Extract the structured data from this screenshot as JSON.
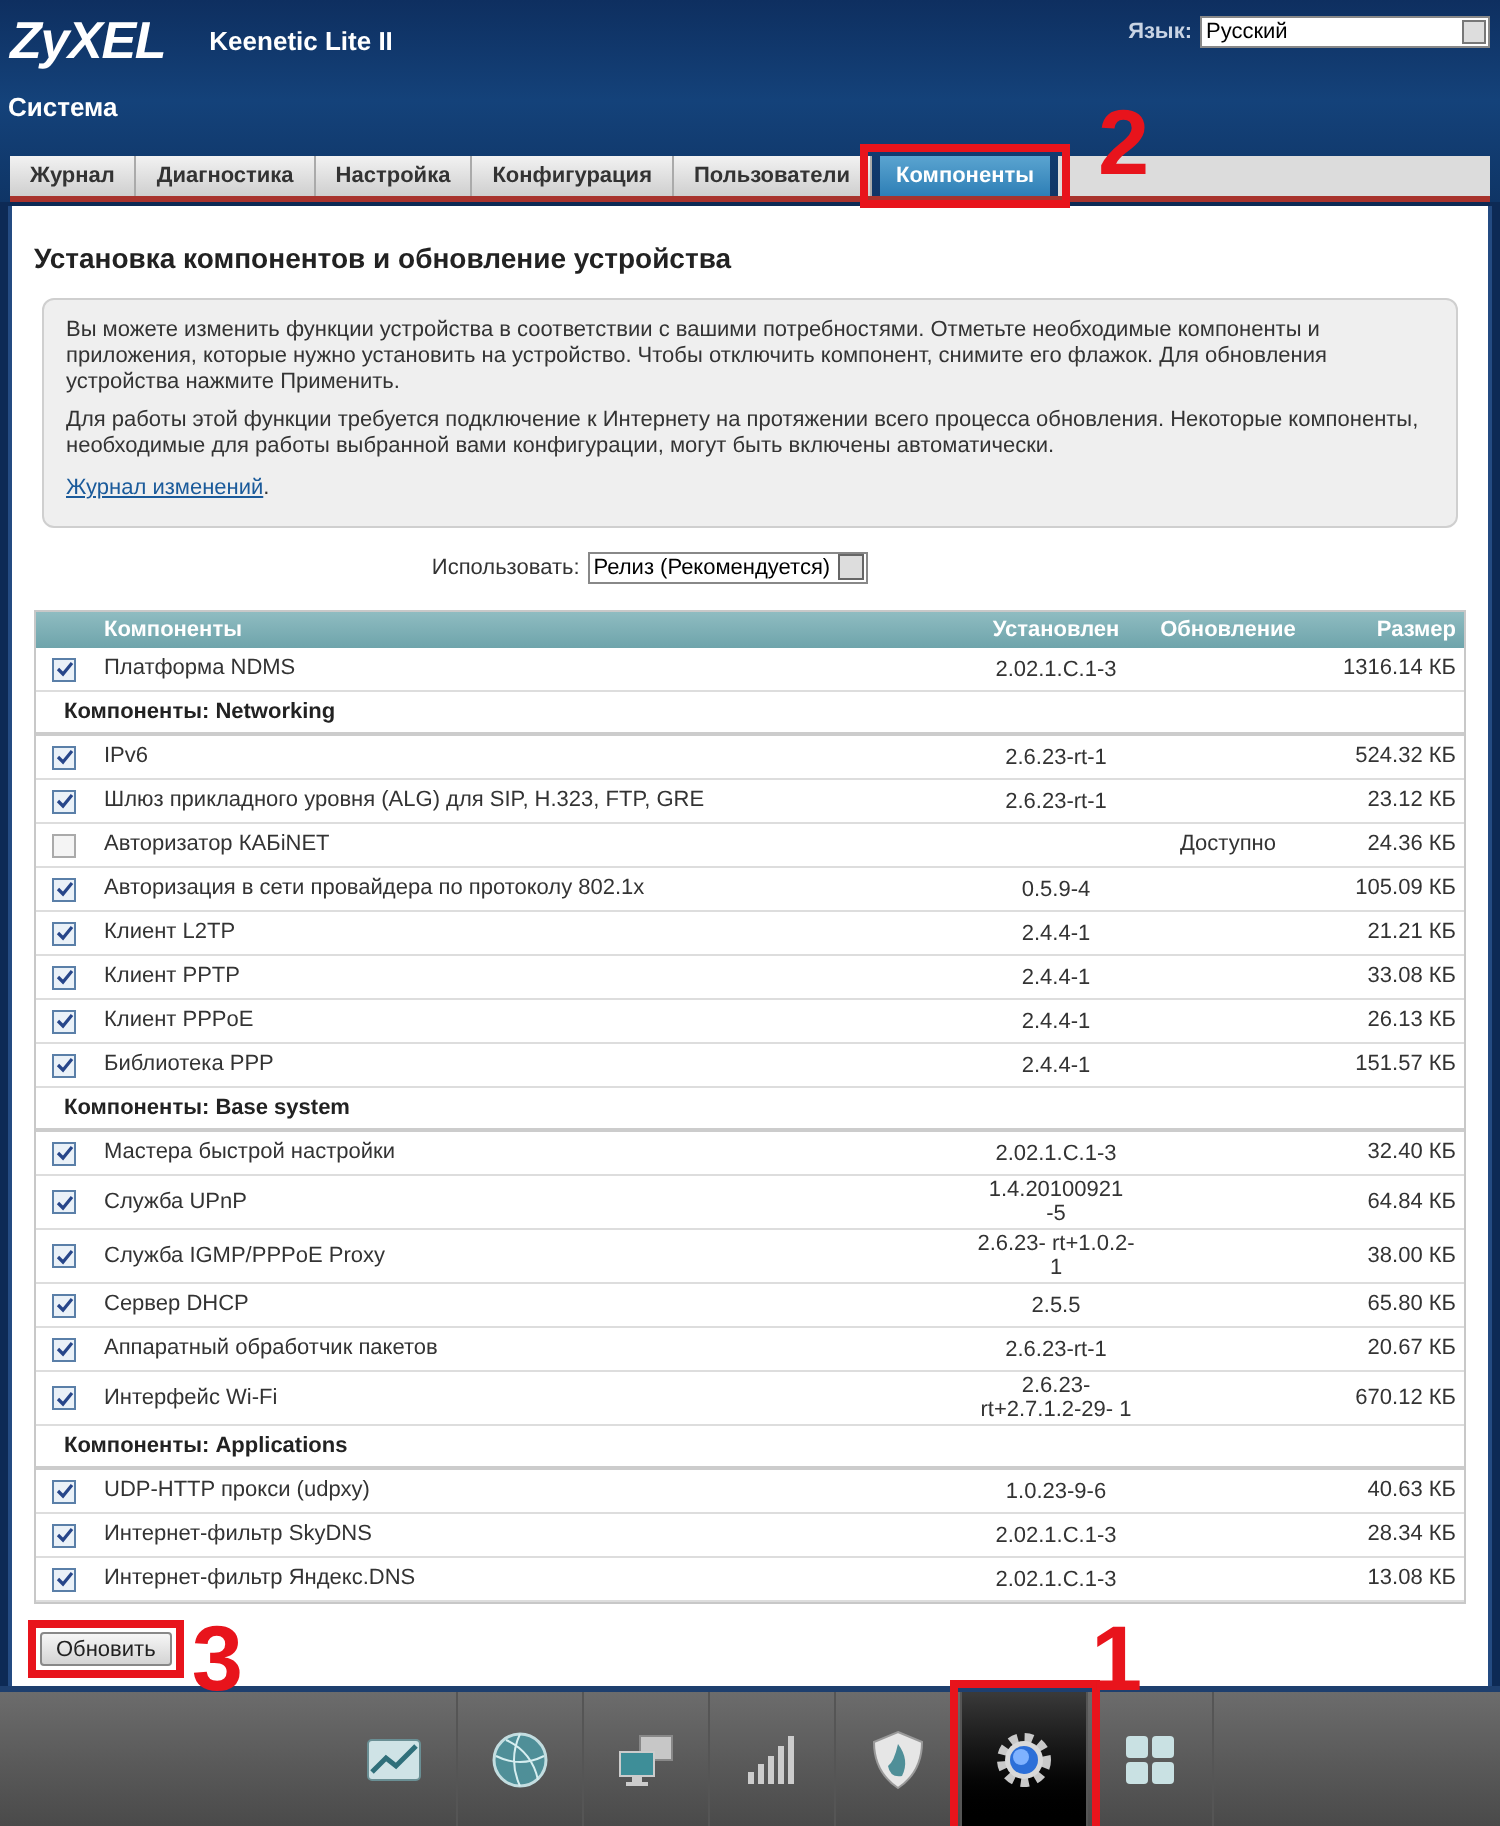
{
  "header": {
    "logo": "ZyXEL",
    "model": "Keenetic Lite II",
    "language_label": "Язык:",
    "language": "Русский",
    "section_title": "Система"
  },
  "tabs": [
    {
      "label": "Журнал",
      "selected": false
    },
    {
      "label": "Диагностика",
      "selected": false
    },
    {
      "label": "Настройка",
      "selected": false
    },
    {
      "label": "Конфигурация",
      "selected": false
    },
    {
      "label": "Пользователи",
      "selected": false
    },
    {
      "label": "Компоненты",
      "selected": true
    }
  ],
  "page_title": "Установка компонентов и обновление устройства",
  "info": {
    "paragraphs": [
      "Вы можете изменить функции устройства в соответствии с вашими потребностями. Отметьте необходимые компоненты и приложения, которые нужно установить на устройство. Чтобы отключить компонент, снимите его флажок. Для обновления устройства нажмите Применить.",
      "Для работы этой функции требуется подключение к Интернету на протяжении всего процесса обновления. Некоторые компоненты, необходимые для работы выбранной вами конфигурации, могут быть включены автоматически."
    ],
    "link": "Журнал изменений",
    "link_suffix": "."
  },
  "use": {
    "label": "Использовать:",
    "value": "Релиз (Рекомендуется)"
  },
  "table": {
    "columns": [
      "Компоненты",
      "Установлен",
      "Обновление",
      "Размер"
    ],
    "groups": [
      {
        "rows": [
          {
            "name": "Платформа NDMS",
            "checked": true,
            "installed": "2.02.1.C.1-3",
            "size": "1316.14 КБ"
          }
        ]
      },
      {
        "title": "Компоненты: Networking",
        "rows": [
          {
            "name": "IPv6",
            "checked": true,
            "installed": "2.6.23-rt-1",
            "size": "524.32 КБ"
          },
          {
            "name": "Шлюз прикладного уровня (ALG) для SIP, H.323, FTP, GRE",
            "checked": true,
            "installed": "2.6.23-rt-1",
            "size": "23.12 КБ"
          },
          {
            "name": "Авторизатор КАБiNET",
            "checked": false,
            "update": "Доступно",
            "size": "24.36 КБ"
          },
          {
            "name": "Авторизация в сети провайдера по протоколу 802.1x",
            "checked": true,
            "installed": "0.5.9-4",
            "size": "105.09 КБ"
          },
          {
            "name": "Клиент L2TP",
            "checked": true,
            "installed": "2.4.4-1",
            "size": "21.21 КБ"
          },
          {
            "name": "Клиент PPTP",
            "checked": true,
            "installed": "2.4.4-1",
            "size": "33.08 КБ"
          },
          {
            "name": "Клиент PPPoE",
            "checked": true,
            "installed": "2.4.4-1",
            "size": "26.13 КБ"
          },
          {
            "name": "Библиотека PPP",
            "checked": true,
            "installed": "2.4.4-1",
            "size": "151.57 КБ"
          }
        ]
      },
      {
        "title": "Компоненты: Base system",
        "rows": [
          {
            "name": "Мастера быстрой настройки",
            "checked": true,
            "installed": "2.02.1.C.1-3",
            "size": "32.40 КБ"
          },
          {
            "name": "Служба UPnP",
            "checked": true,
            "installed": "1.4.20100921 -5",
            "size": "64.84 КБ"
          },
          {
            "name": "Служба IGMP/PPPoE Proxy",
            "checked": true,
            "installed": "2.6.23- rt+1.0.2-1",
            "size": "38.00 КБ"
          },
          {
            "name": "Сервер DHCP",
            "checked": true,
            "installed": "2.5.5",
            "size": "65.80 КБ"
          },
          {
            "name": "Аппаратный обработчик пакетов",
            "checked": true,
            "installed": "2.6.23-rt-1",
            "size": "20.67 КБ"
          },
          {
            "name": "Интерфейс Wi-Fi",
            "checked": true,
            "installed": "2.6.23- rt+2.7.1.2-29- 1",
            "size": "670.12 КБ"
          }
        ]
      },
      {
        "title": "Компоненты: Applications",
        "rows": [
          {
            "name": "UDP-HTTP прокси (udpxy)",
            "checked": true,
            "installed": "1.0.23-9-6",
            "size": "40.63 КБ"
          },
          {
            "name": "Интернет-фильтр SkyDNS",
            "checked": true,
            "installed": "2.02.1.C.1-3",
            "size": "28.34 КБ"
          },
          {
            "name": "Интернет-фильтр Яндекс.DNS",
            "checked": true,
            "installed": "2.02.1.C.1-3",
            "size": "13.08 КБ"
          }
        ]
      }
    ]
  },
  "update_button": "Обновить",
  "dock": [
    {
      "kind": "chart",
      "selected": false
    },
    {
      "kind": "globe",
      "selected": false
    },
    {
      "kind": "computers",
      "selected": false
    },
    {
      "kind": "signal",
      "selected": false
    },
    {
      "kind": "shield",
      "selected": false
    },
    {
      "kind": "gear",
      "selected": true
    },
    {
      "kind": "apps",
      "selected": false
    }
  ],
  "annotations": [
    {
      "label": "2"
    },
    {
      "label": "3"
    },
    {
      "label": "1"
    }
  ]
}
